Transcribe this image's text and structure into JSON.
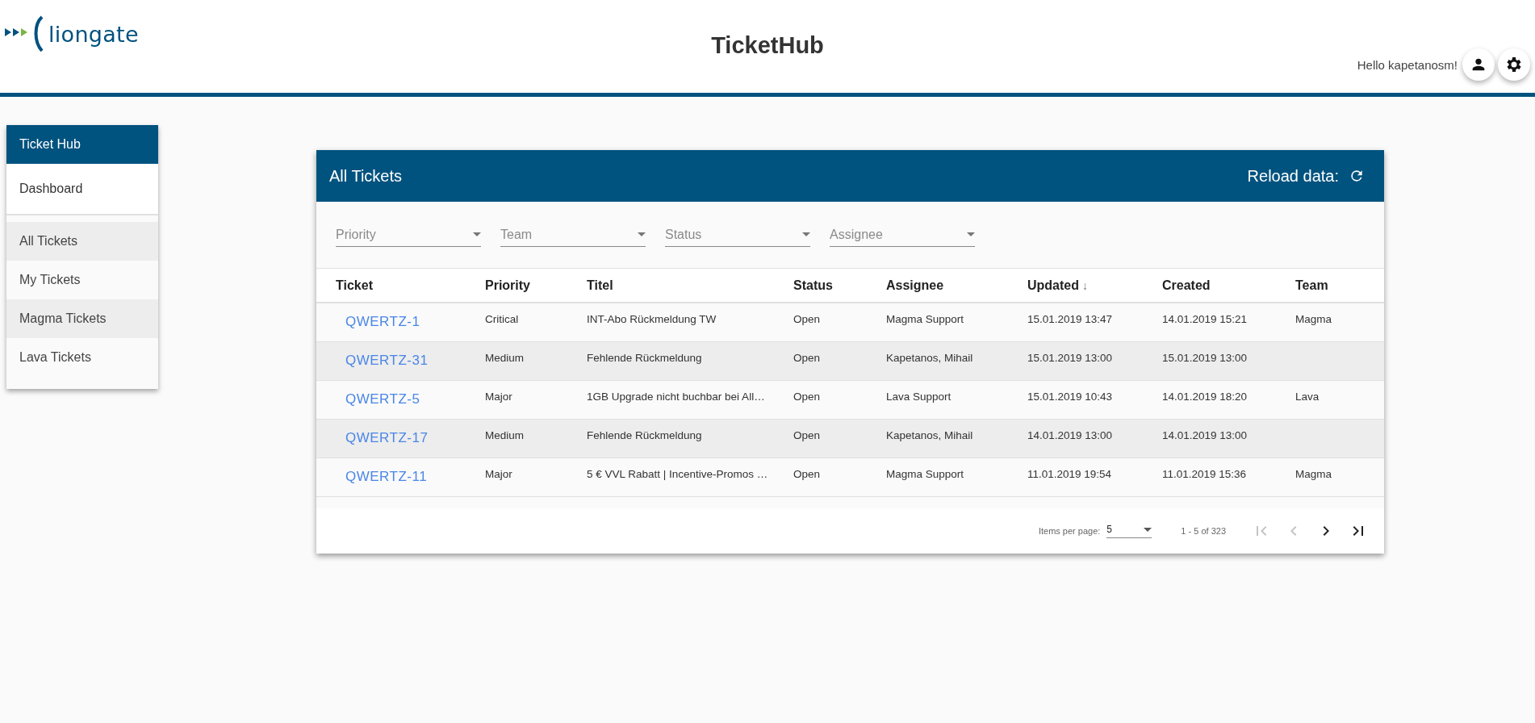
{
  "header": {
    "logo_text": "liongate",
    "title": "TicketHub",
    "greeting": "Hello kapetanosm!"
  },
  "sidebar": {
    "title": "Ticket Hub",
    "top_item": "Dashboard",
    "items": [
      {
        "label": "All Tickets"
      },
      {
        "label": "My Tickets"
      },
      {
        "label": "Magma Tickets"
      },
      {
        "label": "Lava Tickets"
      }
    ]
  },
  "card": {
    "title": "All Tickets",
    "reload_label": "Reload data:",
    "filters": [
      {
        "placeholder": "Priority"
      },
      {
        "placeholder": "Team"
      },
      {
        "placeholder": "Status"
      },
      {
        "placeholder": "Assignee"
      }
    ],
    "columns": [
      {
        "label": "Ticket"
      },
      {
        "label": "Priority"
      },
      {
        "label": "Titel"
      },
      {
        "label": "Status"
      },
      {
        "label": "Assignee"
      },
      {
        "label": "Updated",
        "sort_icon": "↓"
      },
      {
        "label": "Created"
      },
      {
        "label": "Team"
      }
    ],
    "rows": [
      {
        "cells": [
          "QWERTZ-1",
          "Critical",
          "INT-Abo Rückmeldung TW",
          "Open",
          "Magma Support",
          "15.01.2019 13:47",
          "14.01.2019 15:21",
          "Magma"
        ]
      },
      {
        "cells": [
          "QWERTZ-31",
          "Medium",
          "Fehlende Rückmeldung",
          "Open",
          "Kapetanos, Mihail",
          "15.01.2019 13:00",
          "15.01.2019 13:00",
          ""
        ]
      },
      {
        "cells": [
          "QWERTZ-5",
          "Major",
          "1GB Upgrade nicht buchbar bei All…",
          "Open",
          "Lava Support",
          "15.01.2019 10:43",
          "14.01.2019 18:20",
          "Lava"
        ]
      },
      {
        "cells": [
          "QWERTZ-17",
          "Medium",
          "Fehlende Rückmeldung",
          "Open",
          "Kapetanos, Mihail",
          "14.01.2019 13:00",
          "14.01.2019 13:00",
          ""
        ]
      },
      {
        "cells": [
          "QWERTZ-11",
          "Major",
          "5 € VVL Rabatt | Incentive-Promos …",
          "Open",
          "Magma Support",
          "11.01.2019 19:54",
          "11.01.2019 15:36",
          "Magma"
        ]
      }
    ],
    "paginator": {
      "items_label": "Items per page:",
      "page_size": "5",
      "range": "1 - 5 of 323",
      "buttons": [
        {
          "kind": "first",
          "disabled": true
        },
        {
          "kind": "prev",
          "disabled": true
        },
        {
          "kind": "next",
          "disabled": false
        },
        {
          "kind": "last",
          "disabled": false
        }
      ]
    }
  }
}
